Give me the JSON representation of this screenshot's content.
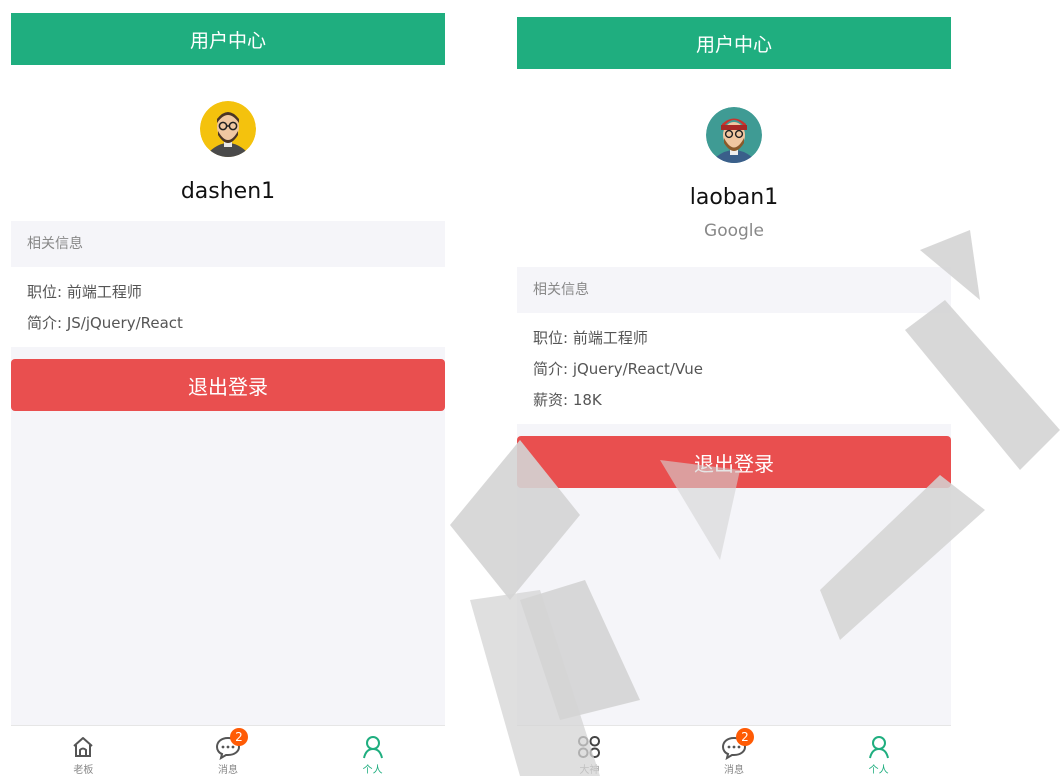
{
  "colors": {
    "accent": "#1fae7f",
    "danger": "#e94f4f",
    "badge": "#ff5b05"
  },
  "left": {
    "navbar_title": "用户中心",
    "username": "dashen1",
    "section_title": "相关信息",
    "position": "职位: 前端工程师",
    "intro": "简介: JS/jQuery/React",
    "logout_label": "退出登录",
    "tabs": [
      {
        "label": "老板",
        "icon": "home-icon"
      },
      {
        "label": "消息",
        "icon": "message-icon",
        "badge": "2"
      },
      {
        "label": "个人",
        "icon": "user-icon"
      }
    ]
  },
  "right": {
    "navbar_title": "用户中心",
    "username": "laoban1",
    "company": "Google",
    "section_title": "相关信息",
    "position": "职位: 前端工程师",
    "intro": "简介: jQuery/React/Vue",
    "salary": "薪资: 18K",
    "logout_label": "退出登录",
    "tabs": [
      {
        "label": "大神",
        "icon": "grid-icon"
      },
      {
        "label": "消息",
        "icon": "message-icon",
        "badge": "2"
      },
      {
        "label": "个人",
        "icon": "user-icon"
      }
    ]
  }
}
